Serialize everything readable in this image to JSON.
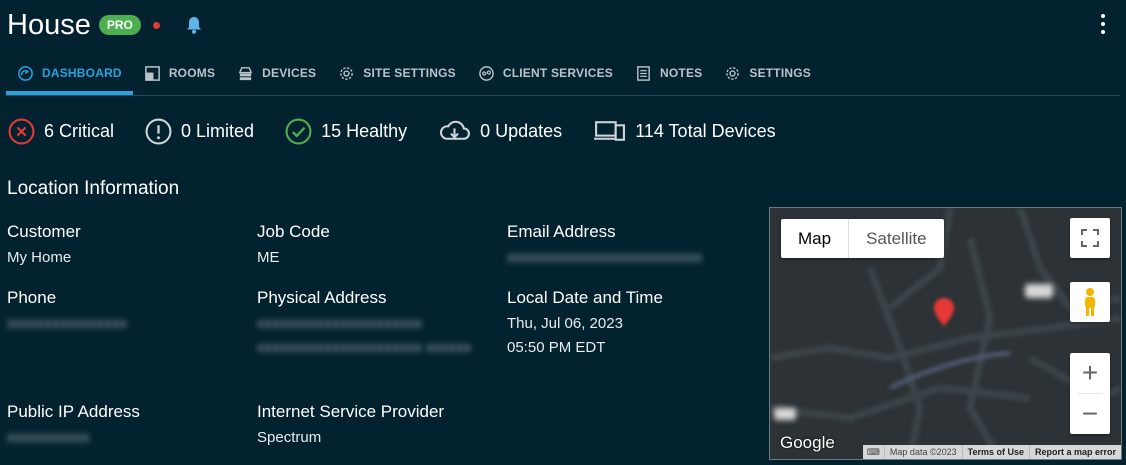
{
  "header": {
    "title": "House",
    "badge": "PRO"
  },
  "tabs": [
    {
      "label": "DASHBOARD",
      "active": true,
      "icon": "dashboard-icon"
    },
    {
      "label": "ROOMS",
      "active": false,
      "icon": "rooms-icon"
    },
    {
      "label": "DEVICES",
      "active": false,
      "icon": "devices-icon"
    },
    {
      "label": "SITE SETTINGS",
      "active": false,
      "icon": "gear-icon"
    },
    {
      "label": "CLIENT SERVICES",
      "active": false,
      "icon": "client-services-icon"
    },
    {
      "label": "NOTES",
      "active": false,
      "icon": "notes-icon"
    },
    {
      "label": "SETTINGS",
      "active": false,
      "icon": "gear-icon"
    }
  ],
  "status": {
    "critical": "6 Critical",
    "limited": "0 Limited",
    "healthy": "15 Healthy",
    "updates": "0 Updates",
    "total": "114 Total Devices"
  },
  "location": {
    "title": "Location Information",
    "customer_label": "Customer",
    "customer_value": "My Home",
    "jobcode_label": "Job Code",
    "jobcode_value": "ME",
    "email_label": "Email Address",
    "phone_label": "Phone",
    "address_label": "Physical Address",
    "datetime_label": "Local Date and Time",
    "date_value": "Thu, Jul 06, 2023",
    "time_value": "05:50 PM EDT",
    "ip_label": "Public IP Address",
    "isp_label": "Internet Service Provider",
    "isp_value": "Spectrum"
  },
  "map": {
    "map_label": "Map",
    "satellite_label": "Satellite",
    "logo": "Google",
    "attribution": "Map data ©2023",
    "terms": "Terms of Use",
    "report": "Report a map error"
  },
  "colors": {
    "background": "#03222f",
    "accent": "#29a3e0",
    "critical": "#e53935",
    "healthy": "#4caf50"
  }
}
